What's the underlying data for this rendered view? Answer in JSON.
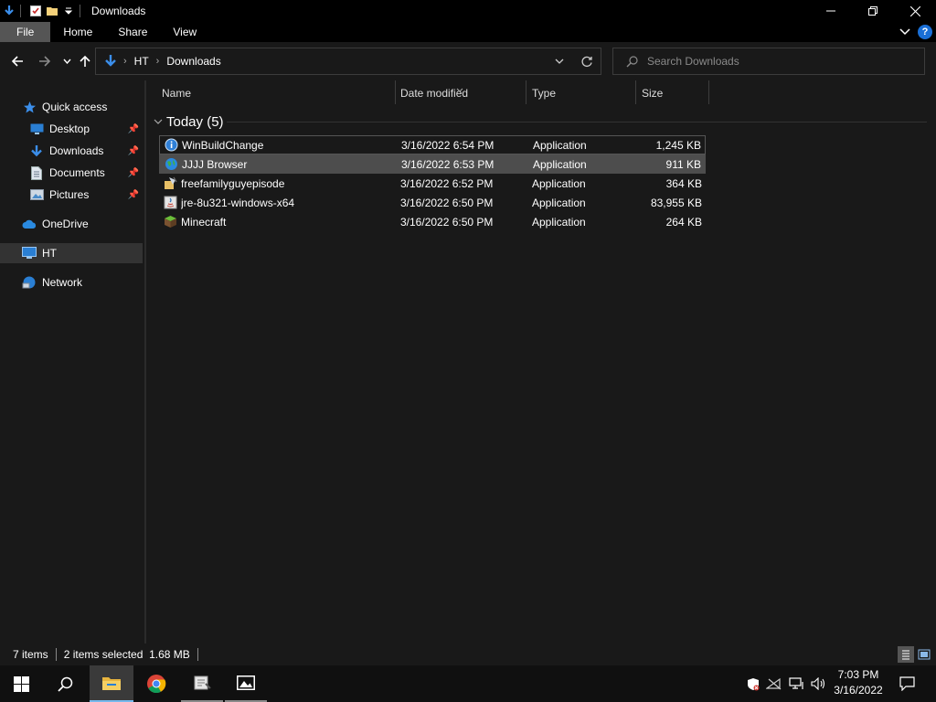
{
  "window": {
    "title": "Downloads"
  },
  "ribbon": {
    "tabs": [
      "File",
      "Home",
      "Share",
      "View"
    ]
  },
  "address": {
    "crumbs": [
      "HT",
      "Downloads"
    ]
  },
  "search": {
    "placeholder": "Search Downloads"
  },
  "sidebar": {
    "items": [
      {
        "label": "Quick access",
        "icon": "star-icon"
      },
      {
        "label": "Desktop",
        "icon": "desktop-icon",
        "pinned": true
      },
      {
        "label": "Downloads",
        "icon": "download-arrow-icon",
        "pinned": true
      },
      {
        "label": "Documents",
        "icon": "document-icon",
        "pinned": true
      },
      {
        "label": "Pictures",
        "icon": "pictures-icon",
        "pinned": true
      },
      {
        "label": "OneDrive",
        "icon": "cloud-icon"
      },
      {
        "label": "HT",
        "icon": "computer-icon",
        "selected": true
      },
      {
        "label": "Network",
        "icon": "network-icon"
      }
    ]
  },
  "columns": {
    "name": "Name",
    "date": "Date modified",
    "type": "Type",
    "size": "Size"
  },
  "group": {
    "label": "Today (5)"
  },
  "files": [
    {
      "name": "WinBuildChange",
      "date": "3/16/2022 6:54 PM",
      "type": "Application",
      "size": "1,245 KB",
      "icon": "info-app-icon"
    },
    {
      "name": "JJJJ Browser",
      "date": "3/16/2022 6:53 PM",
      "type": "Application",
      "size": "911 KB",
      "icon": "globe-icon"
    },
    {
      "name": "freefamilyguyepisode",
      "date": "3/16/2022 6:52 PM",
      "type": "Application",
      "size": "364 KB",
      "icon": "installer-icon"
    },
    {
      "name": "jre-8u321-windows-x64",
      "date": "3/16/2022 6:50 PM",
      "type": "Application",
      "size": "83,955 KB",
      "icon": "java-installer-icon"
    },
    {
      "name": "Minecraft",
      "date": "3/16/2022 6:50 PM",
      "type": "Application",
      "size": "264 KB",
      "icon": "grass-block-icon"
    }
  ],
  "status": {
    "count": "7 items",
    "selection": "2 items selected  1.68 MB"
  },
  "clock": {
    "time": "7:03 PM",
    "date": "3/16/2022"
  },
  "colors": {
    "accent": "#1a6fd6",
    "selected_row": "#4d4d4d",
    "background": "#191919"
  }
}
